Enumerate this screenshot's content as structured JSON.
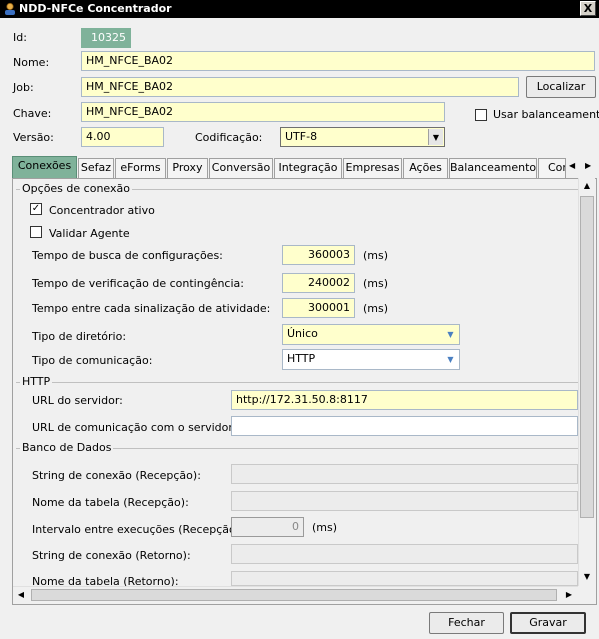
{
  "window": {
    "title": "NDD-NFCe Concentrador",
    "close_glyph": "X"
  },
  "form": {
    "id_label": "Id:",
    "id_value": "10325",
    "nome_label": "Nome:",
    "nome_value": "HM_NFCE_BA02",
    "job_label": "Job:",
    "job_value": "HM_NFCE_BA02",
    "localizar_label": "Localizar",
    "chave_label": "Chave:",
    "chave_value": "HM_NFCE_BA02",
    "usar_balanceamento_label": "Usar balanceamento",
    "versao_label": "Versão:",
    "versao_value": "4.00",
    "codificacao_label": "Codificação:",
    "codificacao_value": "UTF-8"
  },
  "tabs": [
    {
      "label": "Conexões",
      "active": true
    },
    {
      "label": "Sefaz"
    },
    {
      "label": "eForms"
    },
    {
      "label": "Proxy"
    },
    {
      "label": "Conversão"
    },
    {
      "label": "Integração"
    },
    {
      "label": "Empresas"
    },
    {
      "label": "Ações"
    },
    {
      "label": "Balanceamento"
    },
    {
      "label": "Cor"
    }
  ],
  "conexoes": {
    "group_title": "Opções de conexão",
    "concentrador_ativo_label": "Concentrador ativo",
    "concentrador_ativo_checked": true,
    "validar_agente_label": "Validar Agente",
    "validar_agente_checked": false,
    "tempo_busca_label": "Tempo de busca de configurações:",
    "tempo_busca_value": "360003",
    "tempo_verificacao_label": "Tempo de verificação de contingência:",
    "tempo_verificacao_value": "240002",
    "tempo_sinalizacao_label": "Tempo entre cada sinalização de atividade:",
    "tempo_sinalizacao_value": "300001",
    "unit_ms": "(ms)",
    "tipo_diretorio_label": "Tipo de diretório:",
    "tipo_diretorio_value": "Único",
    "tipo_comunicacao_label": "Tipo de comunicação:",
    "tipo_comunicacao_value": "HTTP"
  },
  "http": {
    "group_title": "HTTP",
    "url_servidor_label": "URL do servidor:",
    "url_servidor_value": "http://172.31.50.8:8117",
    "url_comunicacao_label": "URL de comunicação com o servidor:",
    "url_comunicacao_value": ""
  },
  "banco": {
    "group_title": "Banco de Dados",
    "string_recepcao_label": "String de conexão (Recepção):",
    "tabela_recepcao_label": "Nome da tabela (Recepção):",
    "intervalo_label": "Intervalo entre execuções (Recepção):",
    "intervalo_value": "0",
    "string_retorno_label": "String de conexão (Retorno):",
    "tabela_retorno_label": "Nome da tabela (Retorno):"
  },
  "footer": {
    "fechar_label": "Fechar",
    "gravar_label": "Gravar"
  },
  "colors": {
    "accent": "#7fb29a",
    "field_yellow": "#ffffcc"
  }
}
